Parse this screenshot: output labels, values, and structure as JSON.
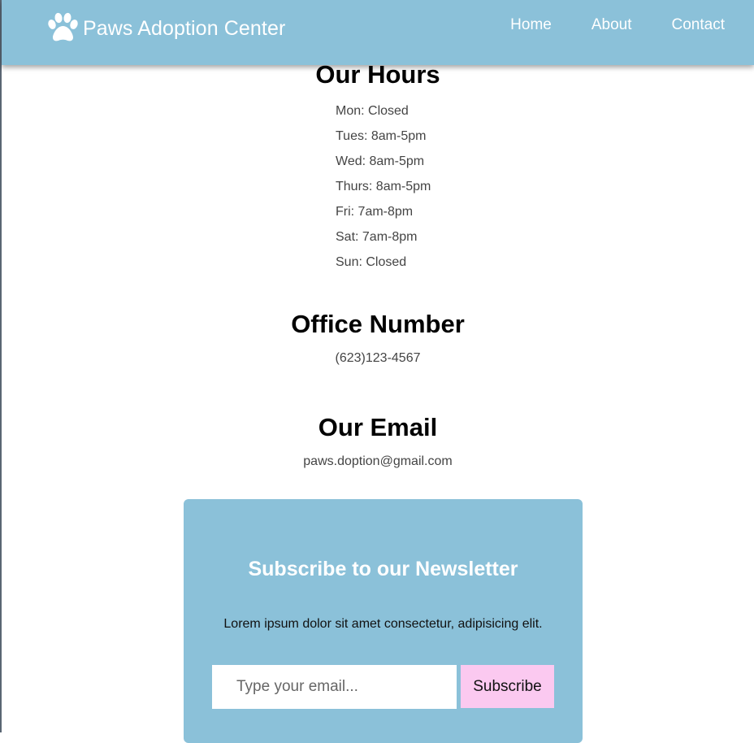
{
  "header": {
    "brand_icon": "paw-icon",
    "brand_name": "Paws Adoption Center",
    "nav": [
      {
        "label": "Home"
      },
      {
        "label": "About"
      },
      {
        "label": "Contact"
      }
    ],
    "bg_color": "#8bc1d9"
  },
  "hours": {
    "title": "Our Hours",
    "items": [
      "Mon: Closed",
      "Tues: 8am-5pm",
      "Wed: 8am-5pm",
      "Thurs: 8am-5pm",
      "Fri: 7am-8pm",
      "Sat: 7am-8pm",
      "Sun: Closed"
    ]
  },
  "office": {
    "title": "Office Number",
    "phone": "(623)123-4567"
  },
  "email_section": {
    "title": "Our Email",
    "email": "paws.doption@gmail.com"
  },
  "newsletter": {
    "title": "Subscribe to our Newsletter",
    "text": "Lorem ipsum dolor sit amet consectetur, adipisicing elit.",
    "input_placeholder": "Type your email...",
    "input_value": "",
    "button_label": "Subscribe",
    "bg_color": "#8bc1d9",
    "button_color": "#fbc9f0"
  }
}
